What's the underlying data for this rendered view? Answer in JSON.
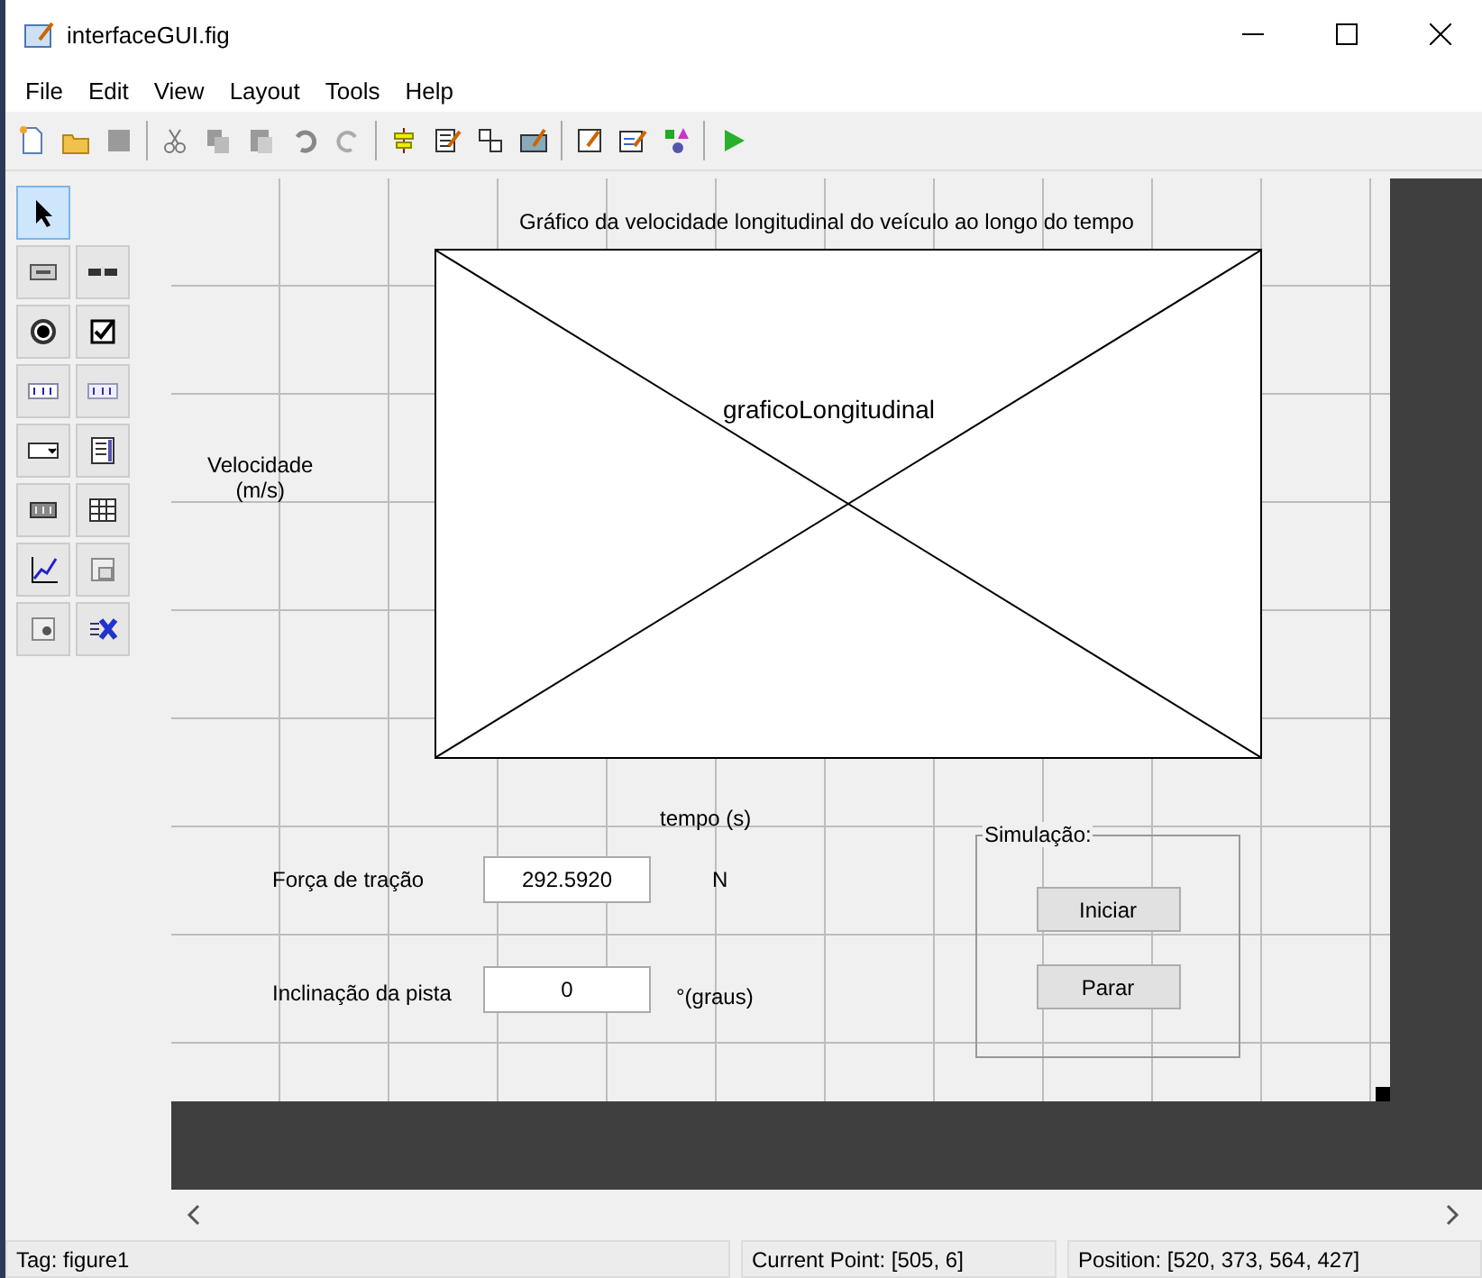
{
  "window": {
    "title": "interfaceGUI.fig"
  },
  "menu": [
    "File",
    "Edit",
    "View",
    "Layout",
    "Tools",
    "Help"
  ],
  "palette": [
    {
      "kind": "select",
      "selected": true
    },
    {
      "kind": "push",
      "selected": false
    },
    {
      "kind": "slider",
      "selected": false
    },
    {
      "kind": "radio",
      "selected": false
    },
    {
      "kind": "check",
      "selected": false
    },
    {
      "kind": "edit",
      "selected": false
    },
    {
      "kind": "text",
      "selected": false
    },
    {
      "kind": "popup",
      "selected": false
    },
    {
      "kind": "listbox",
      "selected": false
    },
    {
      "kind": "toggle",
      "selected": false
    },
    {
      "kind": "table",
      "selected": false
    },
    {
      "kind": "axes",
      "selected": false
    },
    {
      "kind": "panel",
      "selected": false
    },
    {
      "kind": "group",
      "selected": false
    },
    {
      "kind": "activex",
      "selected": false
    }
  ],
  "canvas": {
    "axes_title": "Gráfico da velocidade longitudinal do veículo ao longo do tempo",
    "axes_tag": "graficoLongitudinal",
    "ylabel": "Velocidade\n(m/s)",
    "xlabel": "tempo (s)",
    "fields": [
      {
        "label": "Força de tração",
        "value": "292.5920",
        "unit": "N"
      },
      {
        "label": "Inclinação da pista",
        "value": "0",
        "unit": "°(graus)"
      }
    ],
    "panel": {
      "title": "Simulação:",
      "buttons": [
        "Iniciar",
        "Parar"
      ]
    }
  },
  "status_bar": [
    "Tag: figure1",
    "Current Point:  [505, 6]",
    "Position: [520, 373, 564, 427]"
  ]
}
